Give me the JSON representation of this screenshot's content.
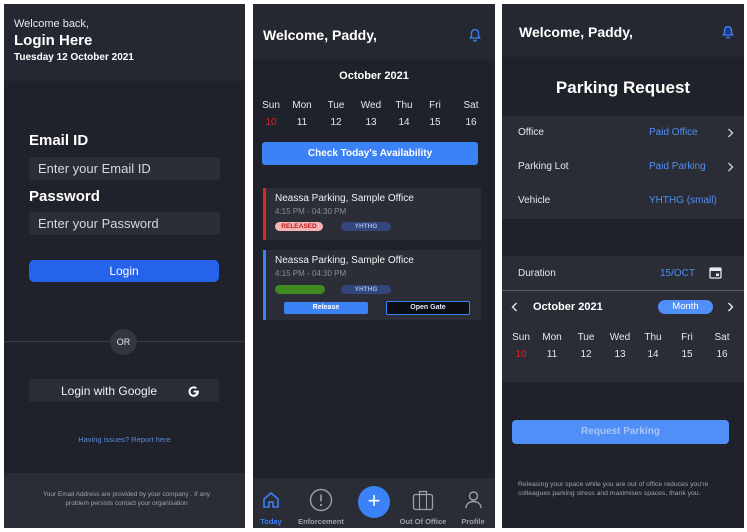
{
  "login": {
    "welcome": "Welcome back,",
    "title": "Login Here",
    "date": "Tuesday 12 October 2021",
    "email_label": "Email ID",
    "email_placeholder": "Enter your Email ID",
    "password_label": "Password",
    "password_placeholder": "Enter your Password",
    "login_button": "Login",
    "or_text": "OR",
    "google_button": "Login with Google",
    "issues_link": "Having issues? Report here",
    "footer": "Your Email Address are provided by your company . If any problem persists contact your organisation"
  },
  "today": {
    "header_title": "Welcome, Paddy,",
    "month": "October 2021",
    "week": [
      {
        "day": "Sun",
        "date": "10"
      },
      {
        "day": "Mon",
        "date": "11"
      },
      {
        "day": "Tue",
        "date": "12"
      },
      {
        "day": "Wed",
        "date": "13"
      },
      {
        "day": "Thu",
        "date": "14"
      },
      {
        "day": "Fri",
        "date": "15"
      },
      {
        "day": "Sat",
        "date": "16"
      }
    ],
    "check_button": "Check Today's Availability",
    "bookings": [
      {
        "title": "Neassa Parking, Sample Office",
        "time": "4:15 PM - 04:30 PM",
        "status": "RELEASED",
        "vehicle": "YHTHG"
      },
      {
        "title": "Neassa Parking, Sample Office",
        "time": "4:15 PM - 04:30 PM",
        "status": "",
        "vehicle": "YHTHG",
        "release_button": "Release",
        "gate_button": "Open Gate"
      }
    ],
    "nav": {
      "today": "Today",
      "enforcement": "Enforcement",
      "add": "+",
      "out_of_office": "Out Of Office",
      "profile": "Profile"
    }
  },
  "request": {
    "header_title": "Welcome, Paddy,",
    "title": "Parking Request",
    "rows": [
      {
        "label": "Office",
        "value": "Paid Office"
      },
      {
        "label": "Parking Lot",
        "value": "Paid Parking"
      },
      {
        "label": "Vehicle",
        "value": "YHTHG (small)"
      }
    ],
    "duration_label": "Duration",
    "duration_value": "15/OCT",
    "month": "October 2021",
    "view_toggle": "Month",
    "week": [
      {
        "day": "Sun",
        "date": "10"
      },
      {
        "day": "Mon",
        "date": "11"
      },
      {
        "day": "Tue",
        "date": "12"
      },
      {
        "day": "Wed",
        "date": "13"
      },
      {
        "day": "Thu",
        "date": "14"
      },
      {
        "day": "Fri",
        "date": "15"
      },
      {
        "day": "Sat",
        "date": "16"
      }
    ],
    "submit_button": "Request Parking",
    "footer": "Releasing your space while you are out of office reduces you're colleagues parking stress and maximises spaces, thank you."
  },
  "colors": {
    "background": "#1f222a",
    "header": "#252830",
    "accent": "#2563eb",
    "link": "#4f8ff7",
    "today_red": "#dc2626",
    "released": "#f8b4b4"
  }
}
